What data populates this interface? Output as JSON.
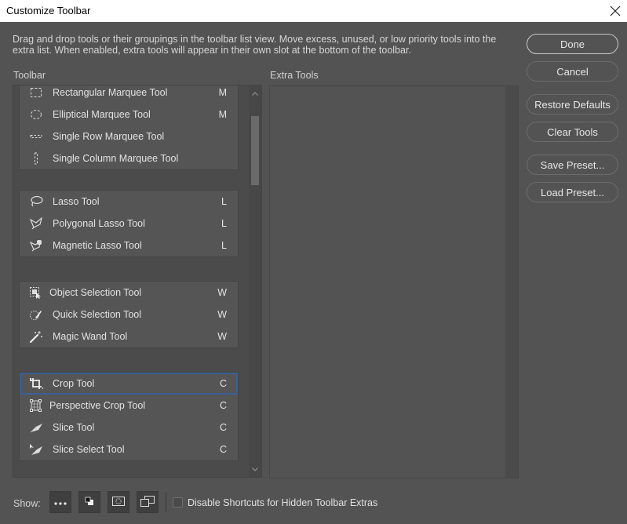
{
  "window": {
    "title": "Customize Toolbar",
    "close_icon": "close-icon"
  },
  "description": "Drag and drop tools or their groupings in the toolbar list view. Move excess, unused, or low priority tools into the extra list. When enabled, extra tools will appear in their own slot at the bottom of the toolbar.",
  "toolbar_label": "Toolbar",
  "extra_tools_label": "Extra Tools",
  "toolbar_groups": [
    {
      "tools": [
        {
          "name": "Rectangular Marquee Tool",
          "shortcut": "M",
          "icon": "rectangular-marquee-icon"
        },
        {
          "name": "Elliptical Marquee Tool",
          "shortcut": "M",
          "icon": "elliptical-marquee-icon"
        },
        {
          "name": "Single Row Marquee Tool",
          "shortcut": "",
          "icon": "single-row-marquee-icon"
        },
        {
          "name": "Single Column Marquee Tool",
          "shortcut": "",
          "icon": "single-column-marquee-icon"
        }
      ]
    },
    {
      "tools": [
        {
          "name": "Lasso Tool",
          "shortcut": "L",
          "icon": "lasso-icon"
        },
        {
          "name": "Polygonal Lasso Tool",
          "shortcut": "L",
          "icon": "polygonal-lasso-icon"
        },
        {
          "name": "Magnetic Lasso Tool",
          "shortcut": "L",
          "icon": "magnetic-lasso-icon"
        }
      ]
    },
    {
      "tools": [
        {
          "name": "Object Selection Tool",
          "shortcut": "W",
          "icon": "object-selection-icon"
        },
        {
          "name": "Quick Selection Tool",
          "shortcut": "W",
          "icon": "quick-selection-icon"
        },
        {
          "name": "Magic Wand Tool",
          "shortcut": "W",
          "icon": "magic-wand-icon"
        }
      ]
    },
    {
      "tools": [
        {
          "name": "Crop Tool",
          "shortcut": "C",
          "icon": "crop-icon",
          "selected": true
        },
        {
          "name": "Perspective Crop Tool",
          "shortcut": "C",
          "icon": "perspective-crop-icon"
        },
        {
          "name": "Slice Tool",
          "shortcut": "C",
          "icon": "slice-icon"
        },
        {
          "name": "Slice Select Tool",
          "shortcut": "C",
          "icon": "slice-select-icon"
        }
      ]
    }
  ],
  "buttons": {
    "done": "Done",
    "cancel": "Cancel",
    "restore_defaults": "Restore Defaults",
    "clear_tools": "Clear Tools",
    "save_preset": "Save Preset...",
    "load_preset": "Load Preset..."
  },
  "footer": {
    "show_label": "Show:",
    "show_buttons": [
      "more-tools-icon",
      "foreground-background-color-icon",
      "quick-mask-icon",
      "screen-mode-icon"
    ],
    "disable_shortcuts_label": "Disable Shortcuts for Hidden Toolbar Extras",
    "disable_shortcuts_checked": false
  },
  "colors": {
    "background": "#535353",
    "selection_outline": "#3b5f93",
    "titlebar": "#ffffff"
  }
}
